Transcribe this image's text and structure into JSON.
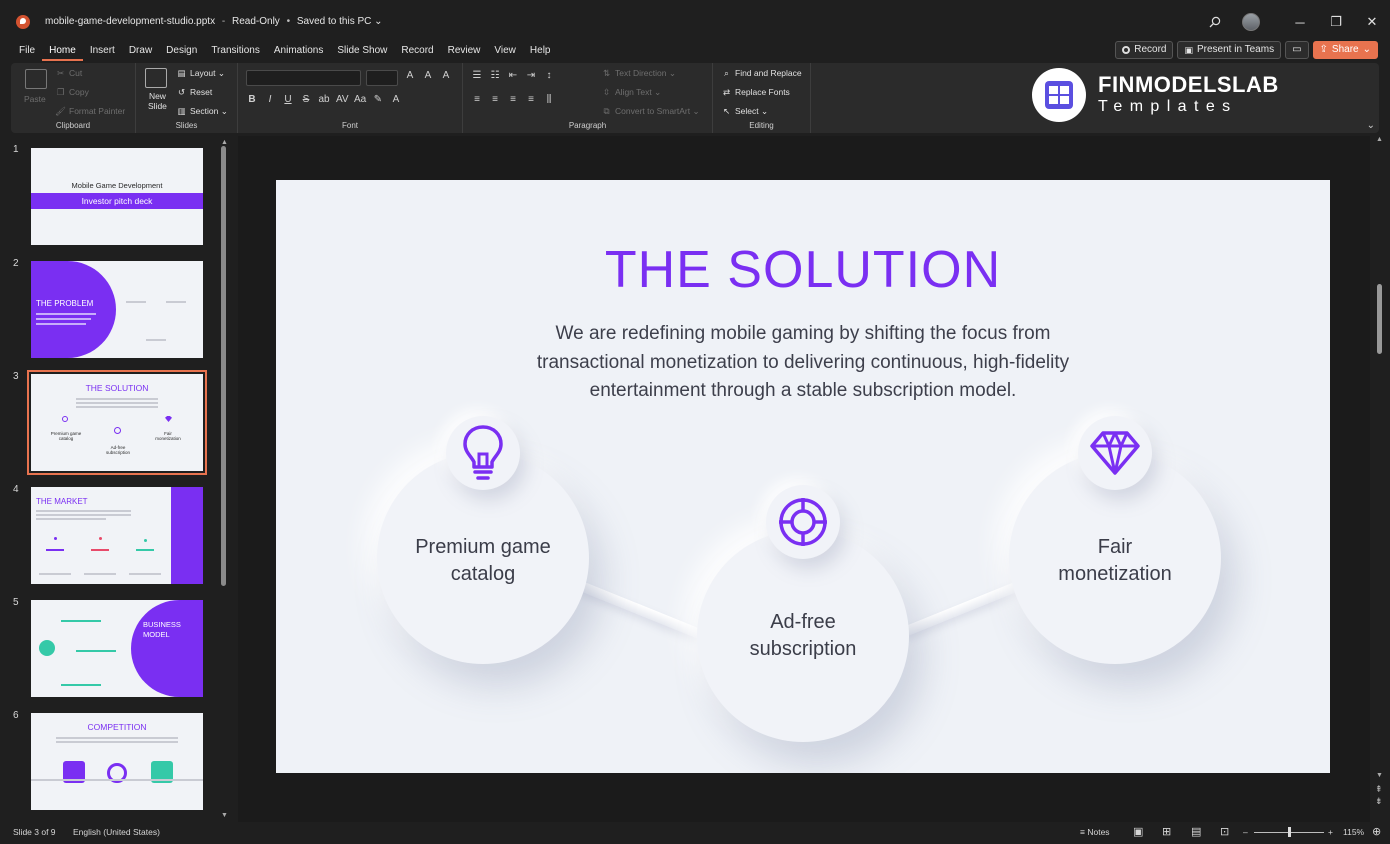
{
  "window": {
    "doc_name": "mobile-game-development-studio.pptx",
    "status1": "Read-Only",
    "status2": "Saved to this PC",
    "dropdown": "⌄",
    "sep": "-",
    "sep2": "•"
  },
  "menu": {
    "tabs": [
      "File",
      "Home",
      "Insert",
      "Draw",
      "Design",
      "Transitions",
      "Animations",
      "Slide Show",
      "Record",
      "Review",
      "View",
      "Help"
    ],
    "active_tab": "Home",
    "record_label": "Record",
    "present_label": "Present in Teams",
    "share_label": "Share"
  },
  "ribbon": {
    "clipboard": {
      "paste": "Paste",
      "cut": "Cut",
      "copy": "Copy",
      "format_painter": "Format Painter",
      "label": "Clipboard"
    },
    "slides": {
      "new_slide_1": "New",
      "new_slide_2": "Slide",
      "layout": "Layout",
      "reset": "Reset",
      "section": "Section",
      "label": "Slides"
    },
    "font": {
      "label": "Font"
    },
    "paragraph": {
      "text_direction": "Text Direction",
      "align_text": "Align Text",
      "convert_smartart": "Convert to SmartArt",
      "label": "Paragraph"
    },
    "editing": {
      "find_replace": "Find and Replace",
      "replace_fonts": "Replace Fonts",
      "select": "Select",
      "label": "Editing"
    },
    "logo": {
      "name": "FINMODELSLAB",
      "sub": "Templates"
    }
  },
  "thumbnails": [
    {
      "number": "1",
      "title": "Mobile Game Development",
      "subtitle": "Investor pitch deck"
    },
    {
      "number": "2",
      "title": "THE PROBLEM"
    },
    {
      "number": "3",
      "title": "THE SOLUTION",
      "items": [
        "Premium game catalog",
        "Ad-free subscription",
        "Fair monetization"
      ]
    },
    {
      "number": "4",
      "title": "THE MARKET"
    },
    {
      "number": "5",
      "title": "BUSINESS",
      "title2": "MODEL"
    },
    {
      "number": "6",
      "title": "COMPETITION"
    }
  ],
  "slide": {
    "title": "THE SOLUTION",
    "body": "We are redefining mobile gaming by shifting the focus from transactional monetization to delivering continuous, high-fidelity entertainment through a stable subscription model.",
    "items": [
      {
        "line1": "Premium game",
        "line2": "catalog",
        "icon": "lightbulb-icon"
      },
      {
        "line1": "Ad-free",
        "line2": "subscription",
        "icon": "target-icon"
      },
      {
        "line1": "Fair",
        "line2": "monetization",
        "icon": "diamond-icon"
      }
    ]
  },
  "statusbar": {
    "slide_info": "Slide 3 of 9",
    "language": "English (United States)",
    "notes": "Notes",
    "zoom": "115%",
    "zoom_minus": "–",
    "zoom_plus": "+"
  },
  "colors": {
    "accent": "#7a2ff2",
    "share": "#e8734f",
    "ribbon_bg": "#2b2b2b"
  }
}
